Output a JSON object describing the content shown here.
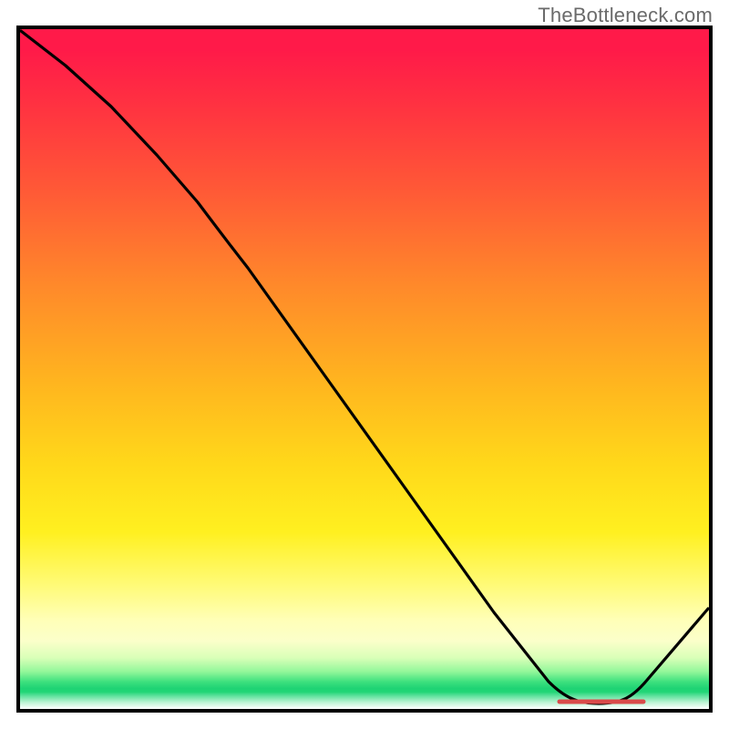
{
  "watermark": "TheBottleneck.com",
  "chart_data": {
    "type": "line",
    "title": "",
    "xlabel": "",
    "ylabel": "",
    "xlim": [
      0,
      100
    ],
    "ylim": [
      0,
      100
    ],
    "grid": false,
    "legend": false,
    "series": [
      {
        "name": "curve",
        "x": [
          0,
          6,
          12,
          18,
          24,
          30,
          42,
          54,
          66,
          76,
          81,
          86,
          90,
          100
        ],
        "y": [
          100,
          95,
          89,
          82,
          75,
          68,
          51,
          34,
          17,
          4,
          1,
          1,
          3,
          14
        ]
      },
      {
        "name": "highlight-segment",
        "x": [
          78,
          90
        ],
        "y": [
          1,
          1
        ]
      }
    ],
    "background_gradient": {
      "direction": "vertical",
      "stops": [
        {
          "pos": 0.0,
          "color": "#ff1a49"
        },
        {
          "pos": 0.24,
          "color": "#ff5a36"
        },
        {
          "pos": 0.52,
          "color": "#ffb51f"
        },
        {
          "pos": 0.74,
          "color": "#fff020"
        },
        {
          "pos": 0.9,
          "color": "#fbffca"
        },
        {
          "pos": 0.96,
          "color": "#3de07e"
        },
        {
          "pos": 1.0,
          "color": "#ffffff"
        }
      ]
    }
  }
}
